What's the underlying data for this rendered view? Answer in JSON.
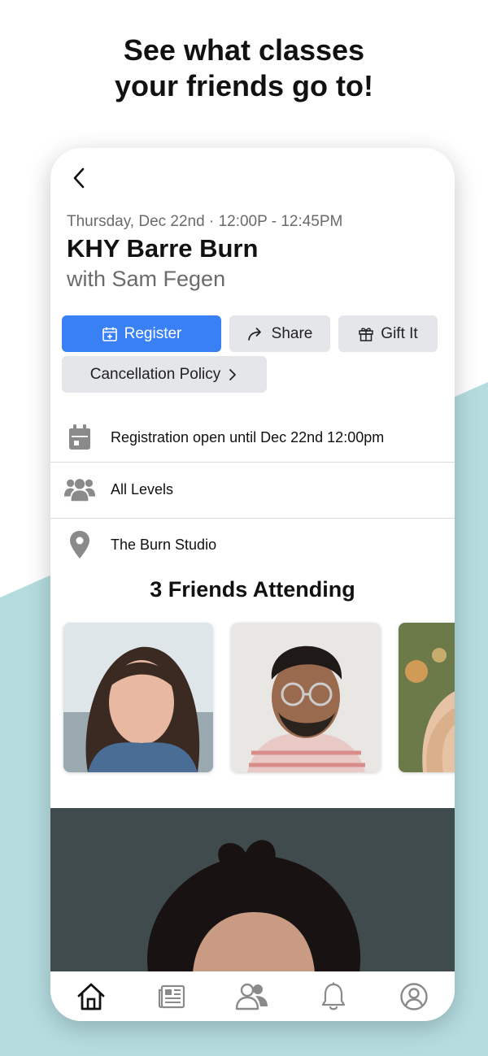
{
  "headline": {
    "line1": "See what classes",
    "line2": "your friends go to!"
  },
  "class": {
    "datetime": "Thursday, Dec 22nd · 12:00P - 12:45PM",
    "title": "KHY Barre Burn",
    "instructor": "with Sam Fegen"
  },
  "actions": {
    "register": "Register",
    "share": "Share",
    "gift": "Gift It",
    "cancellation": "Cancellation Policy"
  },
  "info": {
    "registration": "Registration open until Dec 22nd 12:00pm",
    "level": "All Levels",
    "location": "The Burn Studio"
  },
  "friends": {
    "title": "3 Friends Attending"
  },
  "tabs": [
    {
      "icon": "home-icon"
    },
    {
      "icon": "news-icon"
    },
    {
      "icon": "friends-icon"
    },
    {
      "icon": "bell-icon"
    },
    {
      "icon": "profile-icon"
    }
  ],
  "colors": {
    "accent": "#3a80f5",
    "teal_background": "#b5dde0"
  }
}
